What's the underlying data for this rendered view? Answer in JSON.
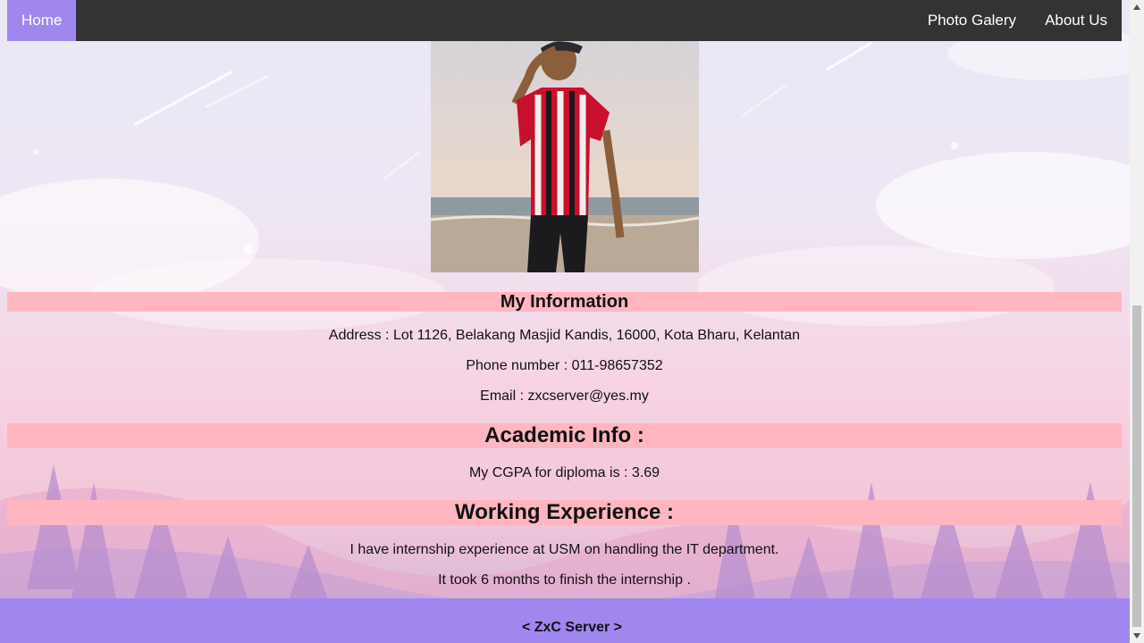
{
  "nav": {
    "home_label": "Home",
    "gallery_label": "Photo Galery",
    "about_label": "About Us"
  },
  "info": {
    "heading": "My Information",
    "address": "Address : Lot 1126, Belakang Masjid Kandis, 16000, Kota Bharu, Kelantan",
    "phone": "Phone number : 011-98657352",
    "email": "Email : zxcserver@yes.my"
  },
  "academic": {
    "heading": "Academic Info :",
    "cgpa": "My CGPA for diploma is : 3.69"
  },
  "work": {
    "heading": "Working Experience :",
    "line1": "I have internship experience at USM on handling the IT department.",
    "line2": "It took 6 months to finish the internship ."
  },
  "footer": {
    "text": "< ZxC Server >"
  },
  "colors": {
    "nav_bg": "#333333",
    "nav_active": "#a087f0",
    "section_bar": "#ffb6c1",
    "footer_bg": "#a087f0"
  },
  "icons": {
    "scroll_up": "triangle-up",
    "scroll_down": "triangle-down"
  }
}
